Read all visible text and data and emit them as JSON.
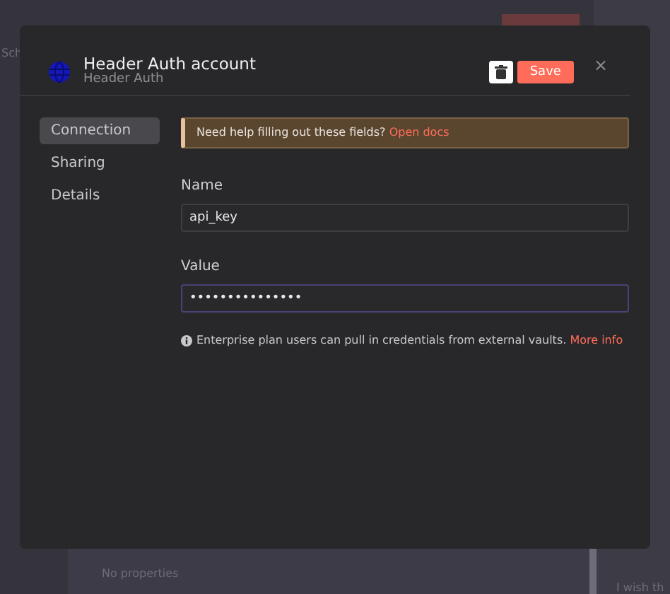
{
  "background": {
    "side_text": "Sch",
    "empty_text": "No properties",
    "hint_text": "I wish th"
  },
  "modal": {
    "title": "Header Auth account",
    "subtitle": "Header Auth",
    "save_label": "Save",
    "close_label": "×",
    "sidebar": [
      {
        "label": "Connection",
        "selected": true
      },
      {
        "label": "Sharing",
        "selected": false
      },
      {
        "label": "Details",
        "selected": false
      }
    ],
    "notice": {
      "text": "Need help filling out these fields?",
      "link": "Open docs"
    },
    "fields": [
      {
        "label": "Name",
        "value": "api_key",
        "focused": false
      },
      {
        "label": "Value",
        "value": "•••••••••••••••",
        "focused": true
      }
    ],
    "info": {
      "text": "Enterprise plan users can pull in credentials from external vaults.",
      "link": "More info"
    }
  }
}
